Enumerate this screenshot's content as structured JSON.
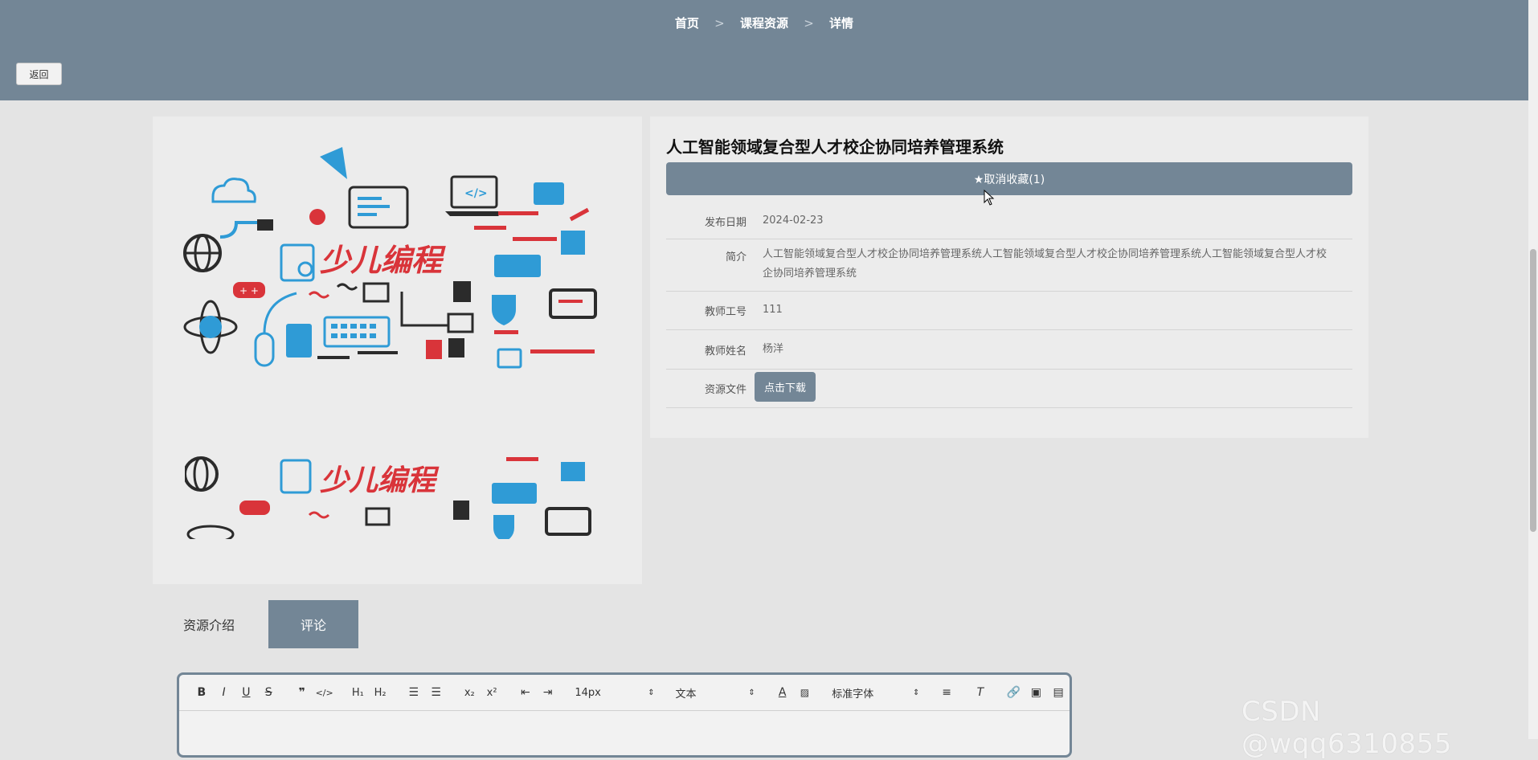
{
  "breadcrumb": {
    "home": "首页",
    "section": "课程资源",
    "current": "详情",
    "separator": ">"
  },
  "back_button": "返回",
  "resource": {
    "title": "人工智能领域复合型人才校企协同培养管理系统",
    "favorite_button": "★取消收藏(1)",
    "fields": {
      "publish_date_label": "发布日期",
      "publish_date_value": "2024-02-23",
      "intro_label": "简介",
      "intro_value": "人工智能领域复合型人才校企协同培养管理系统人工智能领域复合型人才校企协同培养管理系统人工智能领域复合型人才校企协同培养管理系统",
      "teacher_id_label": "教师工号",
      "teacher_id_value": "111",
      "teacher_name_label": "教师姓名",
      "teacher_name_value": "杨洋",
      "file_label": "资源文件",
      "download_button": "点击下载"
    },
    "cover_text": "少儿编程"
  },
  "tabs": {
    "intro": "资源介绍",
    "comment": "评论"
  },
  "editor": {
    "font_size": "14px",
    "block_type": "文本",
    "font_family": "标准字体"
  },
  "watermark": "CSDN @wqq6310855",
  "colors": {
    "accent": "#738696",
    "red": "#d9343a",
    "blue": "#2f9bd6",
    "dark": "#2b2b2b"
  }
}
